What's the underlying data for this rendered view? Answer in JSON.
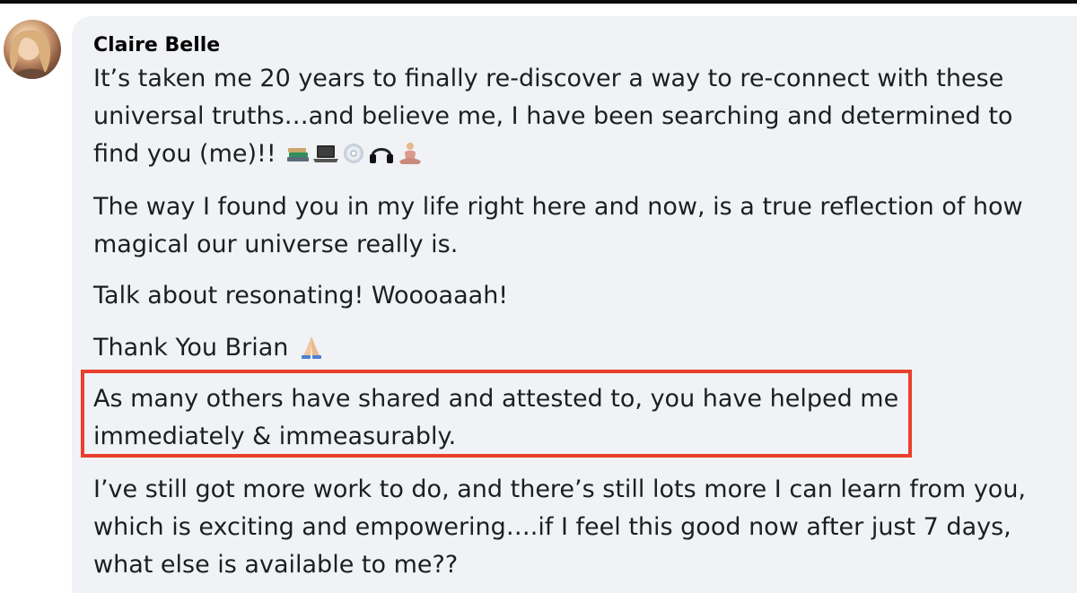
{
  "comment": {
    "author": "Claire Belle",
    "paragraphs": [
      {
        "lines": [
          "It’s taken me 20 years to finally re-discover a way to re-connect with these",
          "universal truths…and believe me, I have been searching and determined to",
          "find you (me)!!"
        ],
        "emojis": [
          "books-icon",
          "laptop-icon",
          "disc-icon",
          "headphones-icon",
          "meditating-person-icon"
        ]
      },
      {
        "lines": [
          "The way I found you in my life right here and now, is a true reflection of how",
          "magical our universe really is."
        ]
      },
      {
        "lines": [
          "Talk about resonating! Woooaaah!"
        ]
      },
      {
        "lines": [
          "Thank You Brian"
        ],
        "emojis": [
          "folded-hands-icon"
        ]
      },
      {
        "lines": [
          "As many others have shared and attested to, you have helped me",
          "immediately & immeasurably."
        ],
        "highlighted": true
      },
      {
        "lines": [
          "I’ve still got more work to do, and there’s still lots more I can learn from you,",
          "which is exciting and empowering….if I feel this good now after just 7 days,",
          "what else is available to me??"
        ]
      }
    ]
  },
  "colors": {
    "bubble_background": "#f0f2f5",
    "text": "#1c1e21",
    "highlight_border": "#e8402c"
  }
}
